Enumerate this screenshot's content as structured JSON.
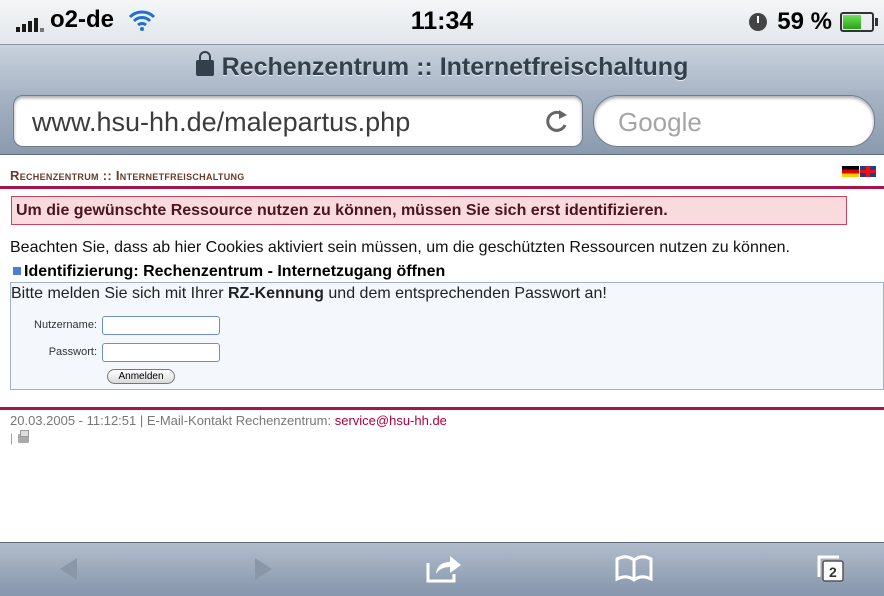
{
  "status": {
    "carrier": "o2-de",
    "time": "11:34",
    "battery_percent": "59 %",
    "battery_level": 0.59
  },
  "browser": {
    "page_title": "Rechenzentrum :: Internetfreischaltung",
    "url": "www.hsu-hh.de/malepartus.php",
    "search_placeholder": "Google",
    "tab_count": "2"
  },
  "page": {
    "site_title": "Rechenzentrum :: Internetfreischaltung",
    "alert": "Um die gewünschte Ressource nutzen zu können, müssen Sie sich erst identifizieren.",
    "cookie_notice": "Beachten Sie, dass ab hier Cookies aktiviert sein müssen, um die geschützten Ressourcen nutzen zu können.",
    "section_heading": "Identifizierung: Rechenzentrum - Internetzugang öffnen",
    "login_intro_pre": "Bitte melden Sie sich mit Ihrer ",
    "login_intro_bold": "RZ-Kennung",
    "login_intro_post": " und dem entsprechenden Passwort an!",
    "username_label": "Nutzername:",
    "password_label": "Passwort:",
    "submit_label": "Anmelden",
    "footer_text": "20.03.2005 - 11:12:51 | E-Mail-Kontakt Rechenzentrum: ",
    "footer_email": "service@hsu-hh.de",
    "print_sep": "|"
  },
  "colors": {
    "accent_rule": "#a5144b",
    "alert_bg": "#f9dadd",
    "link": "#b0003a"
  },
  "icons": [
    "signal-icon",
    "wifi-icon",
    "alarm-icon",
    "battery-icon",
    "lock-icon",
    "reload-icon",
    "flag-de-icon",
    "flag-uk-icon",
    "print-icon",
    "back-icon",
    "forward-icon",
    "share-icon",
    "bookmarks-icon",
    "tabs-icon"
  ]
}
